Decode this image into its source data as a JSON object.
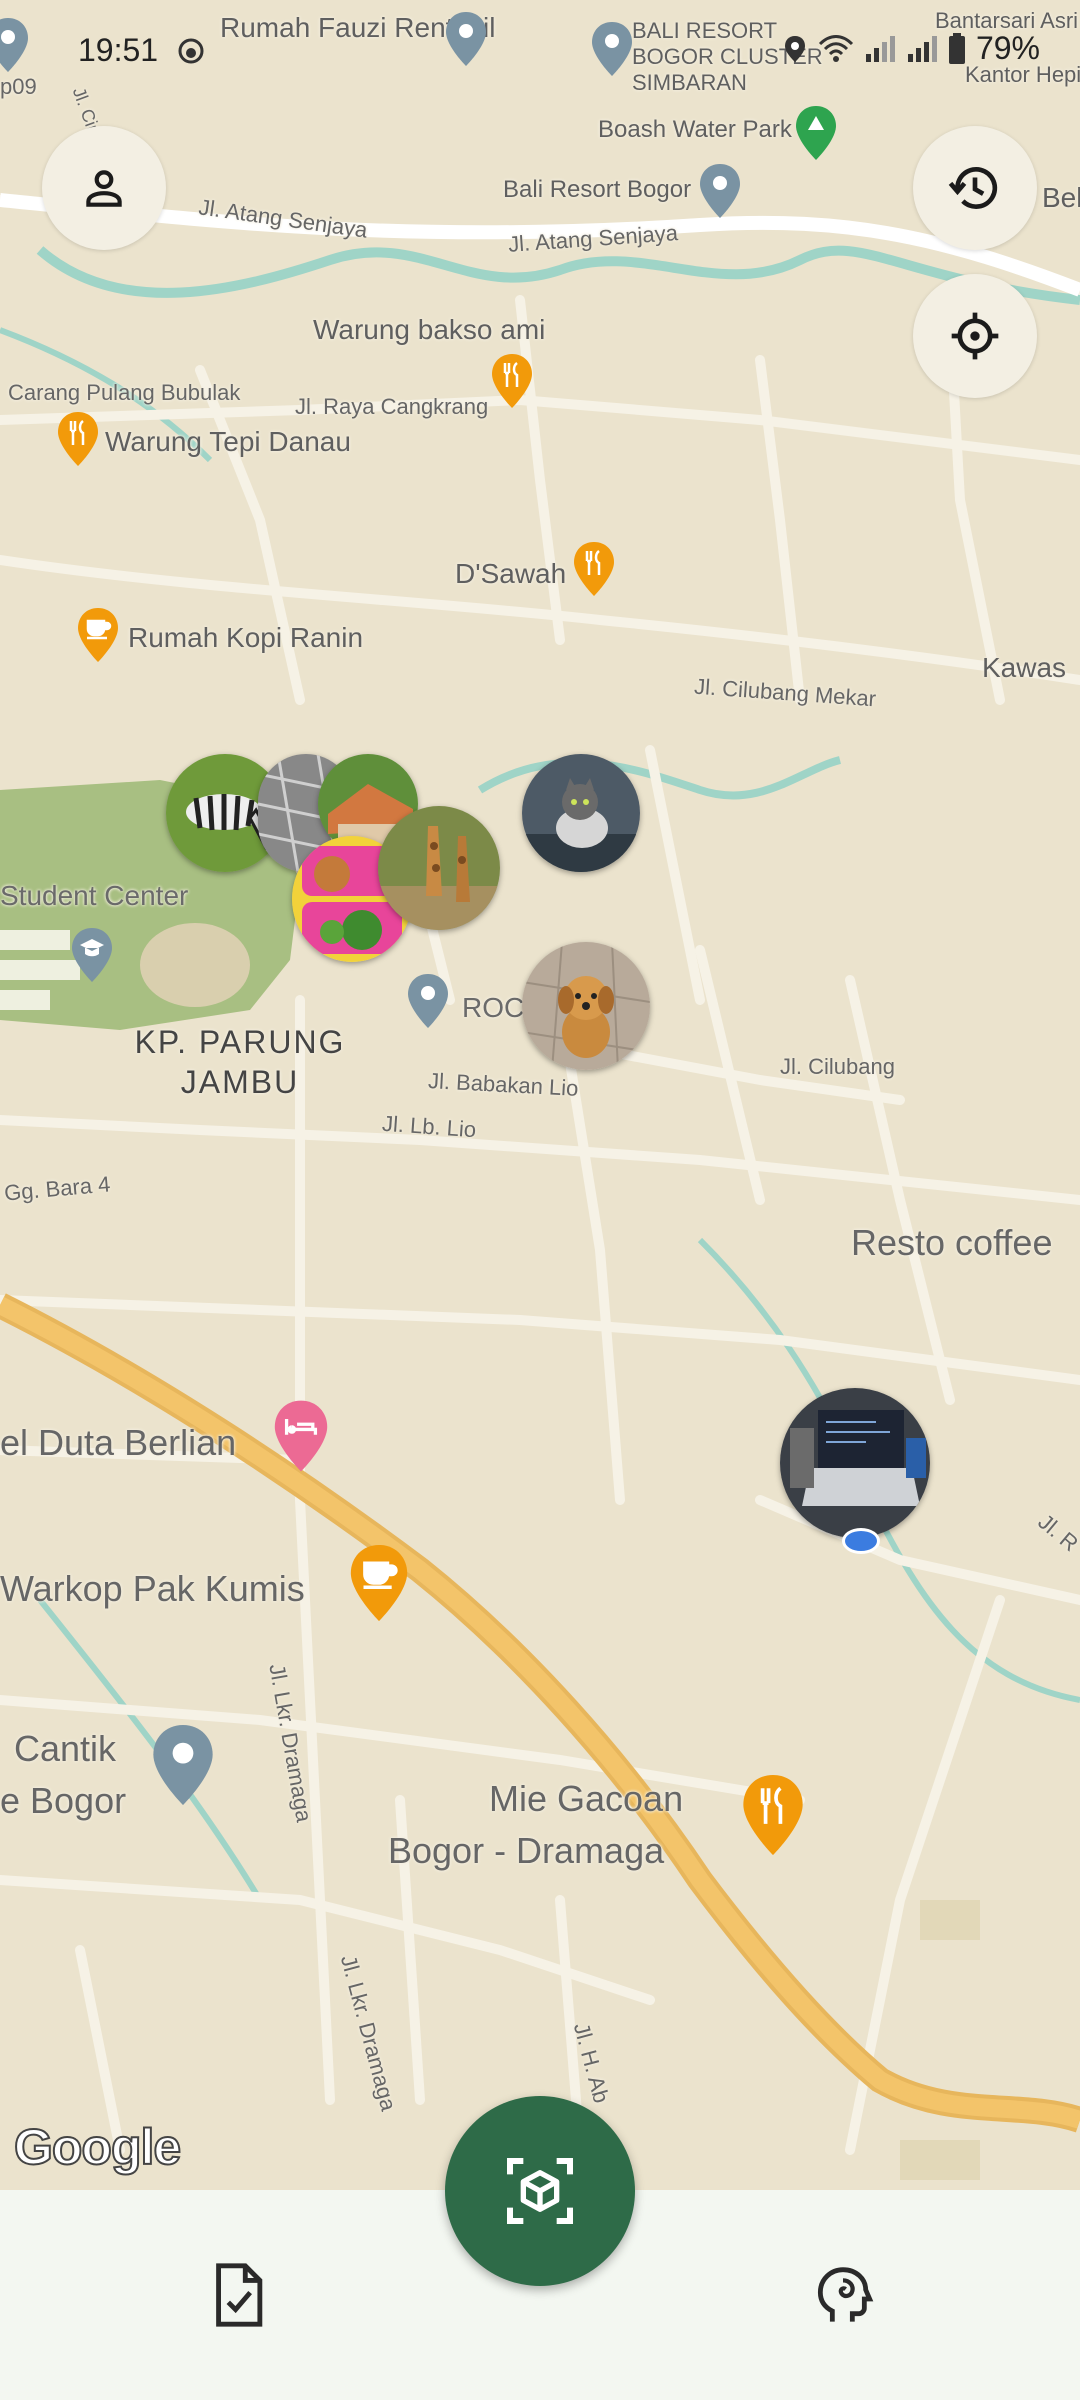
{
  "status_bar": {
    "time": "19:51",
    "battery": "79%"
  },
  "map": {
    "poi_labels": [
      "Rumah Fauzi Rentokil",
      "BALI RESORT BOGOR CLUSTER SIMBARAN",
      "Bantarsari Asri",
      "Kantor Hepi",
      "Boash Water Park",
      "Bali Resort Bogor",
      "Warung bakso ami",
      "Carang Pulang Bubulak",
      "Warung Tepi Danau",
      "D'Sawah",
      "Rumah Kopi Ranin",
      "Kawas",
      "Student Center",
      "ROC",
      "Resto coffee",
      "el Duta Berlian",
      "Warkop Pak Kumis",
      "Cantik",
      "e Bogor",
      "Mie Gacoan",
      "Bogor - Dramaga",
      "p09",
      "Bel"
    ],
    "street_labels": [
      "Jl. Atang Senjaya",
      "Jl. Atang Senjaya",
      "Jl. Raya Cangkrang",
      "Jl. Cilubang Mekar",
      "Jl. Babakan Lio",
      "Jl. Lb. Lio",
      "Jl. Cilubang",
      "Gg. Bara 4",
      "Jl. Lkr. Dramaga",
      "Jl. Lkr. Dramaga",
      "Jl. H. Ab",
      "Jl. R",
      "Jl. Cirulang"
    ],
    "area_label": "KP. PARUNG JAMBU",
    "attribution": "Google",
    "photo_markers": [
      "zebra",
      "tiger",
      "food-tray",
      "giraffe",
      "cat",
      "puppy",
      "laptop"
    ]
  },
  "controls": {
    "profile_icon": "person-icon",
    "history_icon": "history-icon",
    "location_icon": "my-location-icon"
  },
  "bottom_nav": {
    "left_icon": "task-document-icon",
    "center_icon": "ar-scan-cube-icon",
    "right_icon": "psychology-head-icon"
  },
  "colors": {
    "map_bg": "#ebe3cd",
    "road": "#f6f2e6",
    "highway": "#f3c46a",
    "water": "#9fd4c7",
    "park": "#a8bf82",
    "primary_green": "#2e6b48",
    "food_pin": "#f29a0a",
    "hotel_pin": "#ec6a94",
    "place_pin": "#7a93a3",
    "green_pin": "#2ea44f"
  }
}
